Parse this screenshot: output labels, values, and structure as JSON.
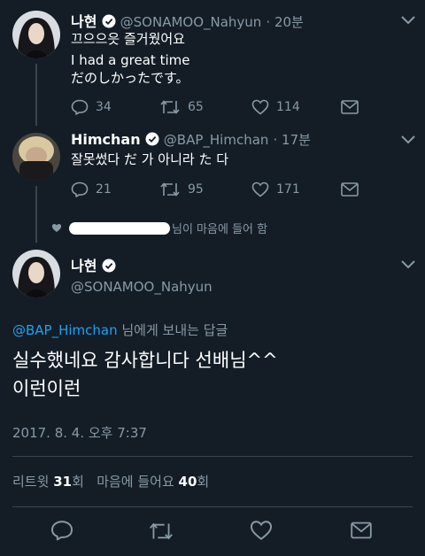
{
  "tweet1": {
    "name": "나현",
    "handle": "@SONAMOO_Nahyun",
    "time": "· 20분",
    "line1": "끄으으읏 즐거웠어요",
    "line2": "I had a great time",
    "line3": "だのしかったです。",
    "replies": "34",
    "retweets": "65",
    "likes": "114"
  },
  "tweet2": {
    "name": "Himchan",
    "handle": "@BAP_Himchan",
    "time": "· 17분",
    "text": "잘못썼다 だ 가 아니라 た 다",
    "replies": "21",
    "retweets": "95",
    "likes": "171"
  },
  "liked_notice": {
    "text": "님이 마음에 들어 함"
  },
  "main_tweet": {
    "name": "나현",
    "handle": "@SONAMOO_Nahyun",
    "reply_to_handle": "@BAP_Himchan",
    "reply_to_suffix": " 님에게 보내는 답글",
    "line1": "실수했네요 감사합니다 선배님^^",
    "line2": "이런이런",
    "timestamp": "2017. 8. 4. 오후 7:37",
    "retweets_label": "리트윗",
    "retweets_count": "31",
    "retweets_unit": "회",
    "likes_label": "마음에 들어요",
    "likes_count": "40",
    "likes_unit": "회"
  },
  "colors": {
    "background": "#141d26",
    "secondary_text": "#8899a6",
    "link": "#1da1f2",
    "verified": "#ffffff"
  }
}
